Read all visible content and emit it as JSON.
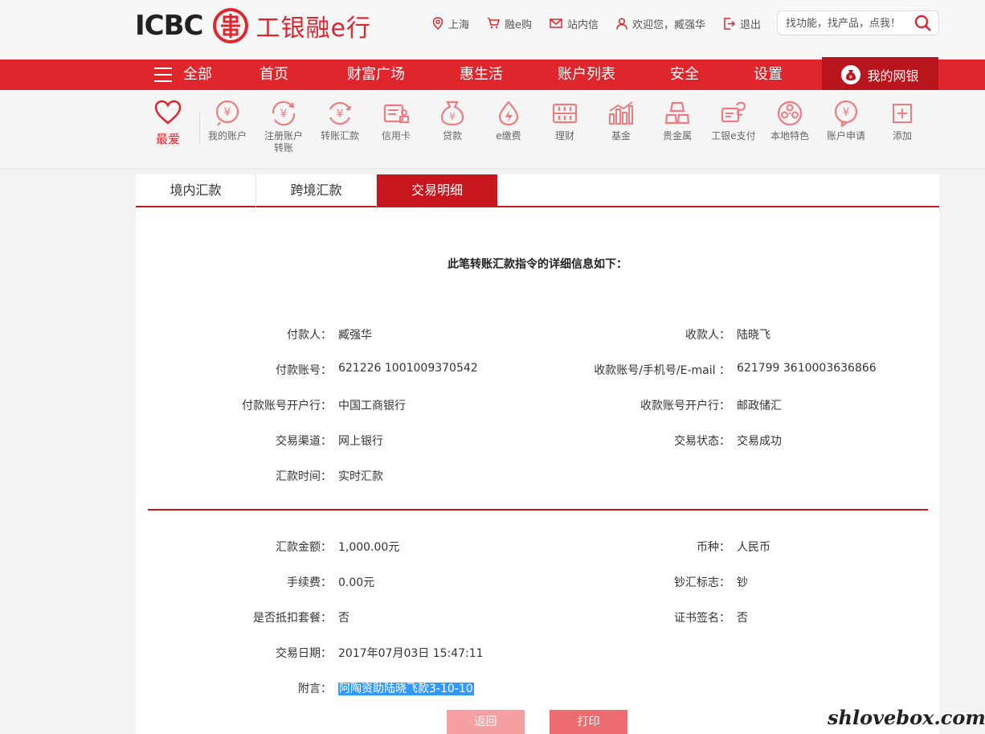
{
  "header": {
    "logo_en": "ICBC",
    "logo_cn": "工银融e行",
    "links": [
      {
        "label": "上海",
        "icon": "location-pin-icon"
      },
      {
        "label": "融e购",
        "icon": "cart-icon"
      },
      {
        "label": "站内信",
        "icon": "mail-icon"
      },
      {
        "label": "欢迎您，臧强华",
        "icon": "user-icon"
      },
      {
        "label": "退出",
        "icon": "logout-icon"
      }
    ],
    "search_placeholder": "找功能，找产品，点我！"
  },
  "nav": {
    "all_label": "全部",
    "items": [
      "首页",
      "财富广场",
      "惠生活",
      "账户列表",
      "安全",
      "设置"
    ],
    "mybank_label": "我的网银"
  },
  "shortcuts": {
    "favorite_label": "最爱",
    "items": [
      {
        "label": "我的账户",
        "icon": "yen-coin-icon"
      },
      {
        "label": "注册账户\n转账",
        "icon": "yen-transfer-icon"
      },
      {
        "label": "转账汇款",
        "icon": "yen-exchange-icon"
      },
      {
        "label": "信用卡",
        "icon": "credit-card-icon"
      },
      {
        "label": "贷款",
        "icon": "money-bag-icon"
      },
      {
        "label": "e缴费",
        "icon": "droplet-bolt-icon"
      },
      {
        "label": "理财",
        "icon": "abacus-icon"
      },
      {
        "label": "基金",
        "icon": "bar-chart-icon"
      },
      {
        "label": "贵金属",
        "icon": "gold-bars-icon"
      },
      {
        "label": "工银e支付",
        "icon": "epay-card-icon"
      },
      {
        "label": "本地特色",
        "icon": "film-reel-icon"
      },
      {
        "label": "账户申请",
        "icon": "yen-apply-icon"
      },
      {
        "label": "添加",
        "icon": "plus-icon"
      }
    ]
  },
  "tabs": [
    "境内汇款",
    "跨境汇款",
    "交易明细"
  ],
  "active_tab": "交易明细",
  "heading": "此笔转账汇款指令的详细信息如下：",
  "details": {
    "payer_label": "付款人：",
    "payer": "臧强华",
    "payee_label": "收款人：",
    "payee": "陆晓飞",
    "payer_account_label": "付款账号：",
    "payer_account": "621226 1001009370542",
    "payee_account_label": "收款账号/手机号/E-mail ：",
    "payee_account": "621799 3610003636866",
    "payer_bank_label": "付款账号开户行：",
    "payer_bank": "中国工商银行",
    "payee_bank_label": "收款账号开户行：",
    "payee_bank": "邮政储汇",
    "channel_label": "交易渠道：",
    "channel": "网上银行",
    "status_label": "交易状态：",
    "status": "交易成功",
    "remit_time_label": "汇款时间：",
    "remit_time": "实时汇款"
  },
  "amounts": {
    "amount_label": "汇款金额：",
    "amount": "1,000.00元",
    "currency_label": "币种：",
    "currency": "人民币",
    "fee_label": "手续费：",
    "fee": "0.00元",
    "cash_flag_label": "钞汇标志：",
    "cash_flag": "钞",
    "package_label": "是否抵扣套餐：",
    "package": "否",
    "cert_label": "证书签名：",
    "cert": "否",
    "date_label": "交易日期：",
    "date": "2017年07月03日 15:47:11",
    "remark_label": "附言：",
    "remark": "阿陶资助陆晓飞款3-10-10"
  },
  "buttons": {
    "back": "返回",
    "print": "打印"
  },
  "watermark": "shlovebox.com",
  "colors": {
    "brand_red": "#e0262d",
    "dark_red": "#c8161e",
    "highlight": "#3399ff"
  }
}
